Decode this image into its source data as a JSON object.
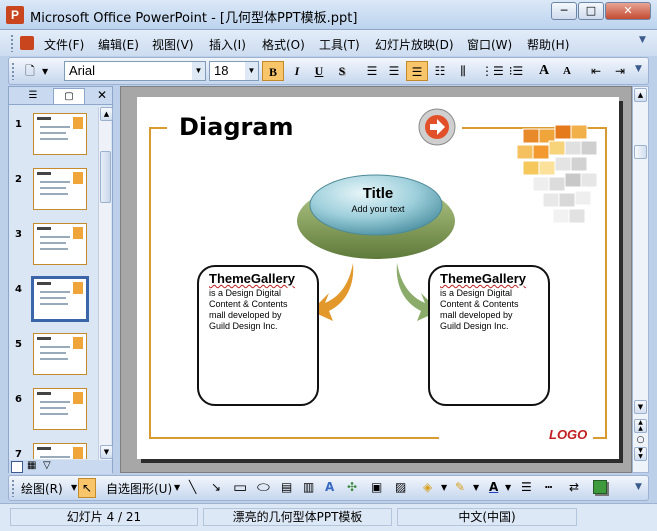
{
  "window": {
    "title": "Microsoft Office PowerPoint - [几何型体PPT模板.ppt]",
    "controls": [
      "minimize",
      "maximize",
      "close"
    ]
  },
  "menu": {
    "items": [
      "文件(F)",
      "编辑(E)",
      "视图(V)",
      "插入(I)",
      "格式(O)",
      "工具(T)",
      "幻灯片放映(D)",
      "窗口(W)",
      "帮助(H)"
    ]
  },
  "toolbar": {
    "font_name": "Arial",
    "font_size": "18",
    "bold": "B",
    "italic": "I",
    "underline": "U",
    "shadow": "S",
    "active_alignment": "align-right",
    "grow_font": "A",
    "shrink_font": "A"
  },
  "slide_panel": {
    "slides": [
      {
        "num": "1"
      },
      {
        "num": "2"
      },
      {
        "num": "3"
      },
      {
        "num": "4",
        "selected": true
      },
      {
        "num": "5"
      },
      {
        "num": "6"
      },
      {
        "num": "7"
      }
    ]
  },
  "slide": {
    "title": "Diagram",
    "center": {
      "title": "Title",
      "subtitle": "Add your text"
    },
    "left_box": {
      "heading": "ThemeGallery",
      "lines": [
        "is a Design Digital",
        "Content & Contents",
        "mall developed by",
        "Guild Design Inc."
      ]
    },
    "right_box": {
      "heading": "ThemeGallery",
      "lines": [
        "is a Design Digital",
        "Content & Contents",
        "mall developed by",
        "Guild Design Inc."
      ]
    },
    "logo": "LOGO",
    "accent_color": "#d99a32",
    "ellipse_color": "#7fb9c6",
    "arrow_left_color": "#e3982c",
    "arrow_right_color": "#8bab6a"
  },
  "draw_toolbar": {
    "draw_label": "绘图(R)",
    "autoshapes_label": "自选图形(U)"
  },
  "status": {
    "slide_info": "幻灯片 4 / 21",
    "design": "漂亮的几何型体PPT模板",
    "language": "中文(中国)"
  }
}
